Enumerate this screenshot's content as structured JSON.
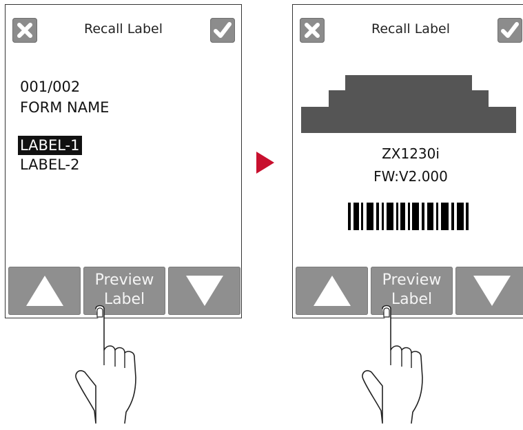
{
  "left_screen": {
    "title": "Recall Label",
    "lines": [
      "001/002",
      "FORM NAME"
    ],
    "labels": [
      {
        "text": "LABEL-1",
        "selected": true
      },
      {
        "text": "LABEL-2",
        "selected": false
      }
    ],
    "preview_button": {
      "line1": "Preview",
      "line2": "Label"
    }
  },
  "right_screen": {
    "title": "Recall Label",
    "model": "ZX1230i",
    "firmware": "FW:V2.000",
    "preview_button": {
      "line1": "Preview",
      "line2": "Label"
    }
  },
  "icons": {
    "cancel": "close-icon",
    "confirm": "check-icon",
    "up": "triangle-up-icon",
    "down": "triangle-down-icon",
    "next": "right-arrow-icon",
    "hand": "pointing-hand-icon"
  },
  "colors": {
    "button_gray": "#8f8f8f",
    "logo_gray": "#555555",
    "arrow_red": "#c8102e",
    "selection": "#111111"
  }
}
